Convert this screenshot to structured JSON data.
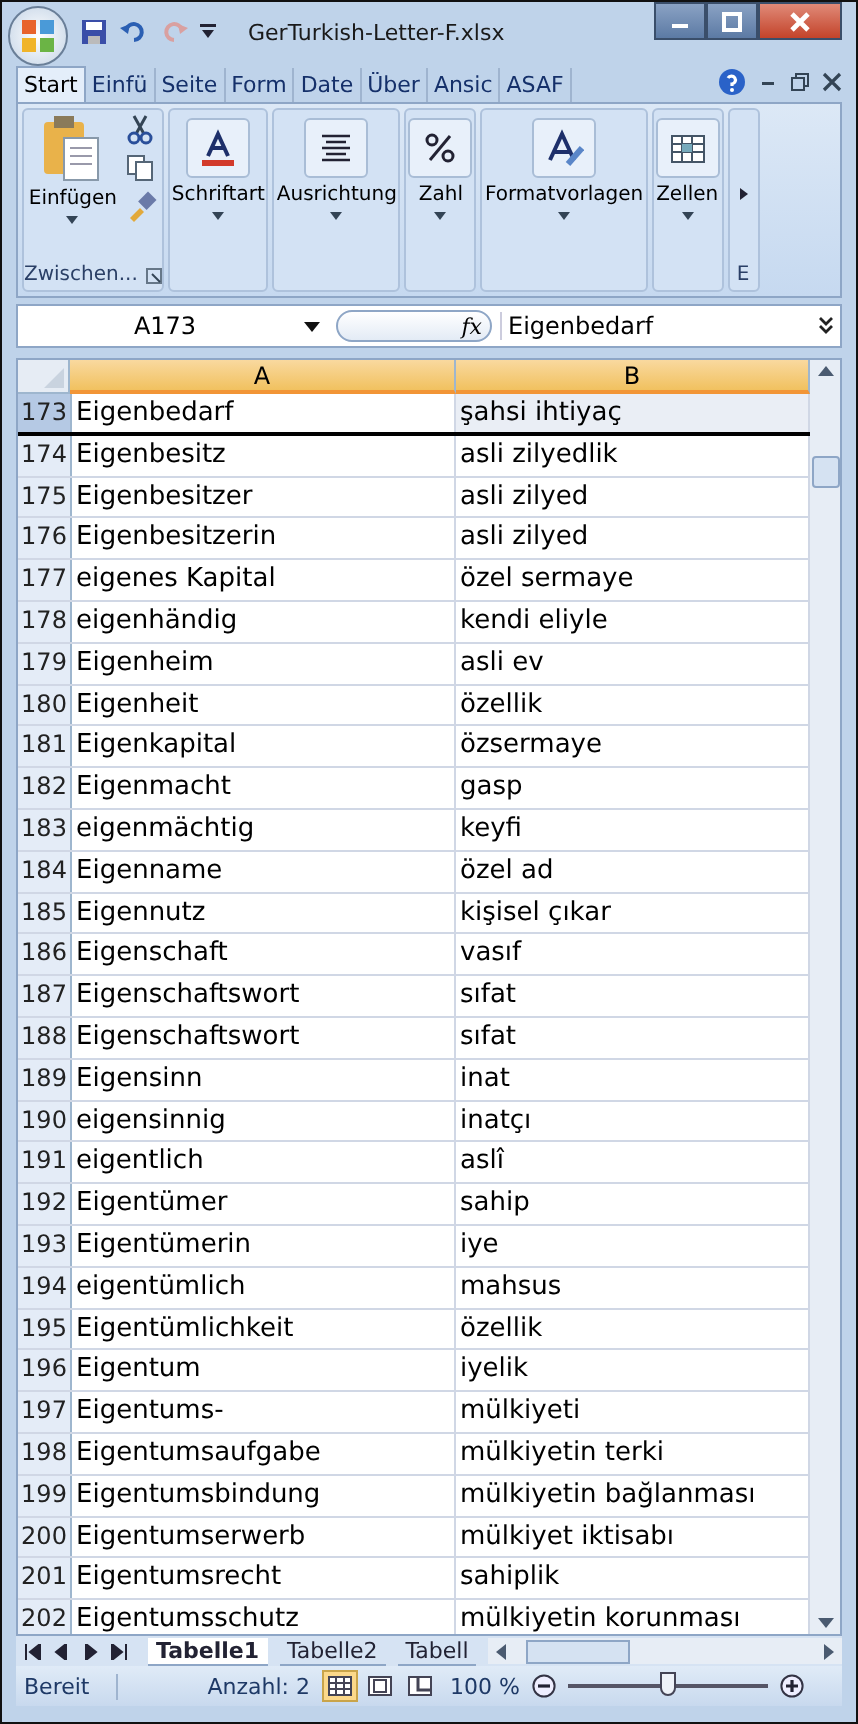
{
  "window": {
    "title": "GerTurkish-Letter-F.xlsx"
  },
  "tabs": [
    {
      "label": "Start",
      "selected": true
    },
    {
      "label": "Einfü",
      "selected": false
    },
    {
      "label": "Seite",
      "selected": false
    },
    {
      "label": "Form",
      "selected": false
    },
    {
      "label": "Date",
      "selected": false
    },
    {
      "label": "Über",
      "selected": false
    },
    {
      "label": "Ansic",
      "selected": false
    },
    {
      "label": "ASAF",
      "selected": false
    }
  ],
  "ribbon": {
    "groups": [
      {
        "kind": "clipboard",
        "button": "Einfügen",
        "label": "Zwischen..."
      },
      {
        "kind": "font",
        "button": "Schriftart"
      },
      {
        "kind": "align",
        "button": "Ausrichtung"
      },
      {
        "kind": "number",
        "button": "Zahl"
      },
      {
        "kind": "styles",
        "button": "Formatvorlagen"
      },
      {
        "kind": "cells",
        "button": "Zellen"
      },
      {
        "kind": "partial",
        "label": "E"
      }
    ]
  },
  "formula_bar": {
    "name_box": "A173",
    "fx": "fx",
    "value": "Eigenbedarf"
  },
  "table": {
    "columns": [
      {
        "label": "A",
        "selected": true
      },
      {
        "label": "B",
        "selected": true
      }
    ],
    "rows": [
      {
        "num": "173",
        "a": "Eigenbedarf",
        "b": "şahsi ihtiyaç",
        "selected": true
      },
      {
        "num": "174",
        "a": "Eigenbesitz",
        "b": "asli zilyedlik",
        "selected": false
      },
      {
        "num": "175",
        "a": "Eigenbesitzer",
        "b": "asli zilyed",
        "selected": false
      },
      {
        "num": "176",
        "a": "Eigenbesitzerin",
        "b": "asli zilyed",
        "selected": false
      },
      {
        "num": "177",
        "a": "eigenes Kapital",
        "b": "özel sermaye",
        "selected": false
      },
      {
        "num": "178",
        "a": "eigenhändig",
        "b": "kendi eliyle",
        "selected": false
      },
      {
        "num": "179",
        "a": "Eigenheim",
        "b": "asli ev",
        "selected": false
      },
      {
        "num": "180",
        "a": "Eigenheit",
        "b": "özellik",
        "selected": false
      },
      {
        "num": "181",
        "a": "Eigenkapital",
        "b": "özsermaye",
        "selected": false
      },
      {
        "num": "182",
        "a": "Eigenmacht",
        "b": "gasp",
        "selected": false
      },
      {
        "num": "183",
        "a": "eigenmächtig",
        "b": "keyfi",
        "selected": false
      },
      {
        "num": "184",
        "a": "Eigenname",
        "b": "özel ad",
        "selected": false
      },
      {
        "num": "185",
        "a": "Eigennutz",
        "b": "kişisel çıkar",
        "selected": false
      },
      {
        "num": "186",
        "a": "Eigenschaft",
        "b": "vasıf",
        "selected": false
      },
      {
        "num": "187",
        "a": "Eigenschaftswort",
        "b": "sıfat",
        "selected": false
      },
      {
        "num": "188",
        "a": "Eigenschaftswort",
        "b": "sıfat",
        "selected": false
      },
      {
        "num": "189",
        "a": "Eigensinn",
        "b": "inat",
        "selected": false
      },
      {
        "num": "190",
        "a": "eigensinnig",
        "b": "inatçı",
        "selected": false
      },
      {
        "num": "191",
        "a": "eigentlich",
        "b": "aslî",
        "selected": false
      },
      {
        "num": "192",
        "a": "Eigentümer",
        "b": "sahip",
        "selected": false
      },
      {
        "num": "193",
        "a": "Eigentümerin",
        "b": "iye",
        "selected": false
      },
      {
        "num": "194",
        "a": "eigentümlich",
        "b": "mahsus",
        "selected": false
      },
      {
        "num": "195",
        "a": "Eigentümlichkeit",
        "b": "özellik",
        "selected": false
      },
      {
        "num": "196",
        "a": "Eigentum",
        "b": "iyelik",
        "selected": false
      },
      {
        "num": "197",
        "a": "Eigentums-",
        "b": "mülkiyeti",
        "selected": false
      },
      {
        "num": "198",
        "a": "Eigentumsaufgabe",
        "b": "mülkiyetin terki",
        "selected": false
      },
      {
        "num": "199",
        "a": "Eigentumsbindung",
        "b": "mülkiyetin bağlanması",
        "selected": false
      },
      {
        "num": "200",
        "a": "Eigentumserwerb",
        "b": "mülkiyet iktisabı",
        "selected": false
      },
      {
        "num": "201",
        "a": "Eigentumsrecht",
        "b": "sahiplik",
        "selected": false
      },
      {
        "num": "202",
        "a": "Eigentumsschutz",
        "b": "mülkiyetin korunması",
        "selected": false
      }
    ]
  },
  "sheet_tabs": [
    {
      "label": "Tabelle1",
      "selected": true
    },
    {
      "label": "Tabelle2",
      "selected": false
    },
    {
      "label": "Tabell",
      "selected": false
    }
  ],
  "status_bar": {
    "mode": "Bereit",
    "count": "Anzahl: 2",
    "views": [
      {
        "kind": "normal",
        "selected": true
      },
      {
        "kind": "layout",
        "selected": false
      },
      {
        "kind": "pagebreak",
        "selected": false
      }
    ],
    "zoom": "100 %",
    "zoom_slider": {
      "level": 0.5
    }
  }
}
